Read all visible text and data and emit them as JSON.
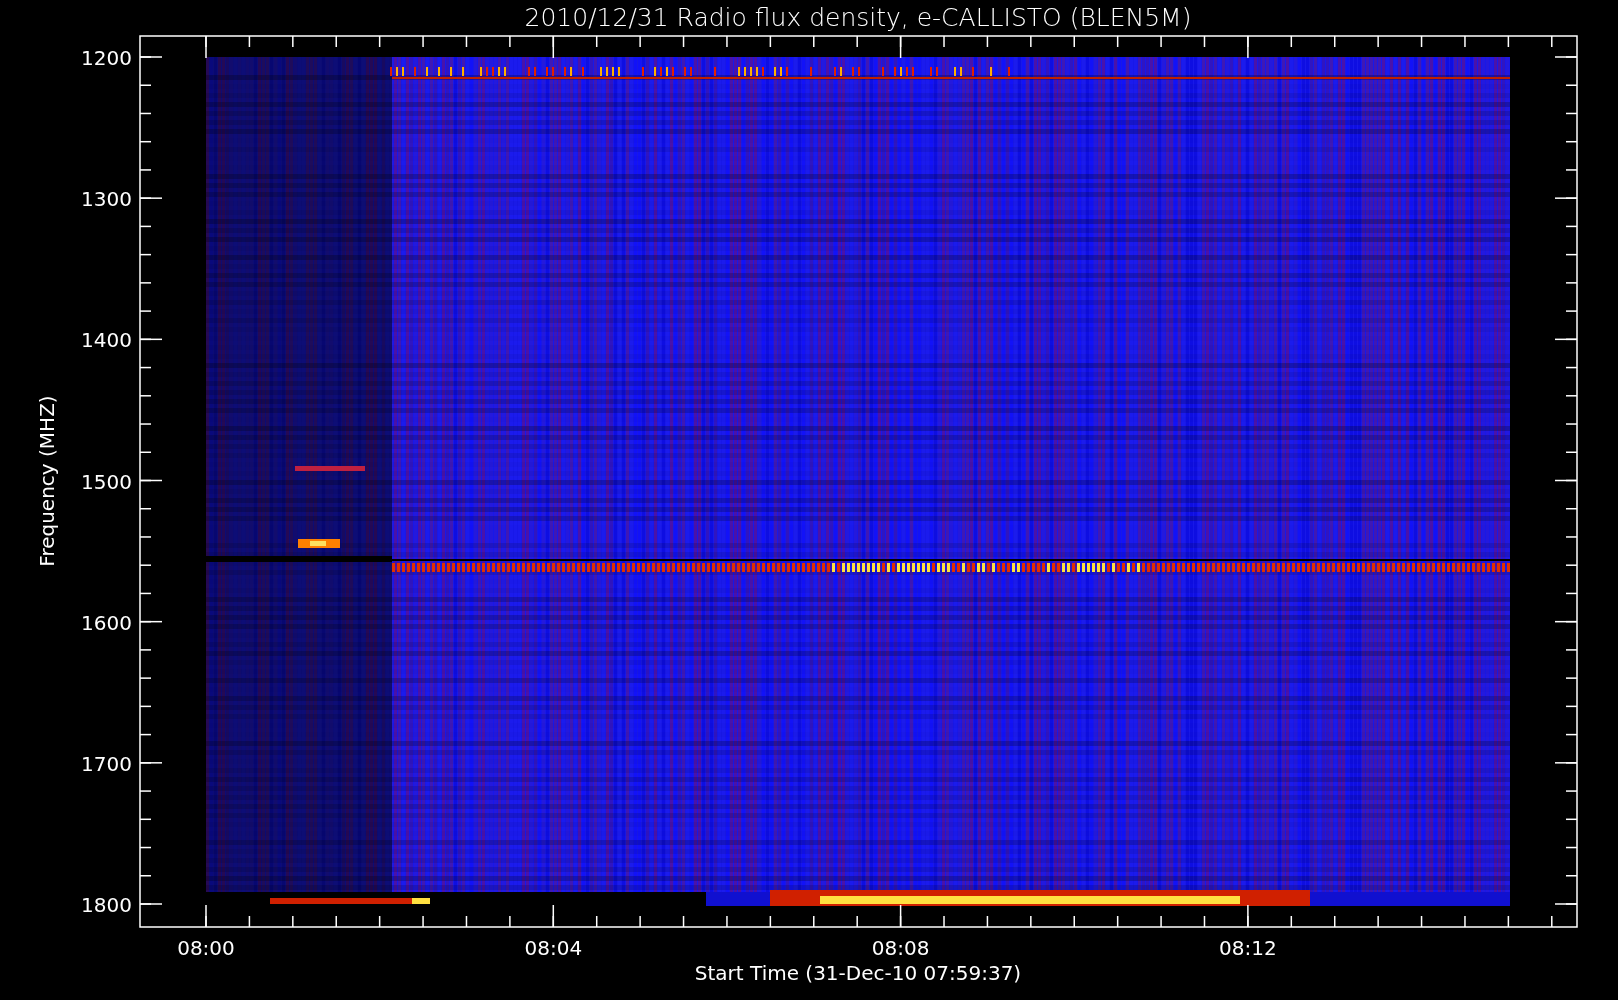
{
  "title": "2010/12/31  Radio flux density, e-CALLISTO (BLEN5M)",
  "y_axis": {
    "label": "Frequency (MHZ)",
    "ticks": [
      "1200",
      "1300",
      "1400",
      "1500",
      "1600",
      "1700",
      "1800"
    ]
  },
  "x_axis": {
    "label": "Start Time (31-Dec-10 07:59:37)",
    "ticks": [
      "08:00",
      "08:04",
      "08:08",
      "08:12"
    ]
  }
}
